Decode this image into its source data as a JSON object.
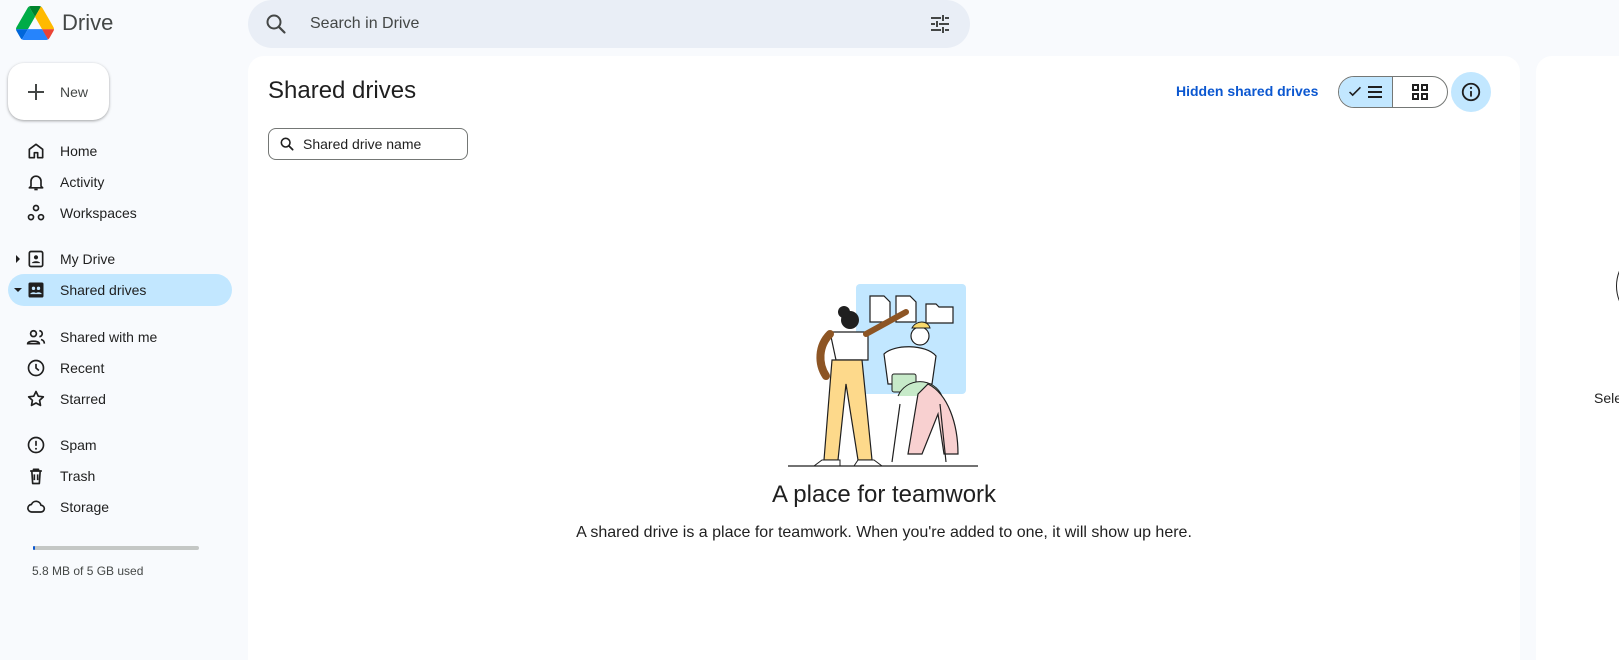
{
  "app": {
    "name": "Drive"
  },
  "search": {
    "placeholder": "Search in Drive"
  },
  "sidebar": {
    "new_label": "New",
    "items": [
      {
        "label": "Home",
        "icon": "home-icon"
      },
      {
        "label": "Activity",
        "icon": "bell-icon"
      },
      {
        "label": "Workspaces",
        "icon": "workspaces-icon"
      },
      {
        "label": "My Drive",
        "icon": "my-drive-icon"
      },
      {
        "label": "Shared drives",
        "icon": "shared-drives-icon",
        "active": true
      },
      {
        "label": "Shared with me",
        "icon": "people-icon"
      },
      {
        "label": "Recent",
        "icon": "clock-icon"
      },
      {
        "label": "Starred",
        "icon": "star-icon"
      },
      {
        "label": "Spam",
        "icon": "spam-icon"
      },
      {
        "label": "Trash",
        "icon": "trash-icon"
      },
      {
        "label": "Storage",
        "icon": "cloud-icon"
      }
    ],
    "storage": {
      "text": "5.8 MB of 5 GB used",
      "used_fraction": 0.0012
    }
  },
  "main": {
    "title": "Shared drives",
    "hidden_link": "Hidden shared drives",
    "view": "list",
    "drive_search_placeholder": "Shared drive name",
    "empty_title": "A place for teamwork",
    "empty_description": "A shared drive is a place for teamwork. When you're added to one, it will show up here."
  },
  "right_panel": {
    "text_fragment": "Sele"
  },
  "colors": {
    "accent": "#0b57d0",
    "active_bg": "#c2e7ff",
    "page_bg": "#f8fafd"
  }
}
